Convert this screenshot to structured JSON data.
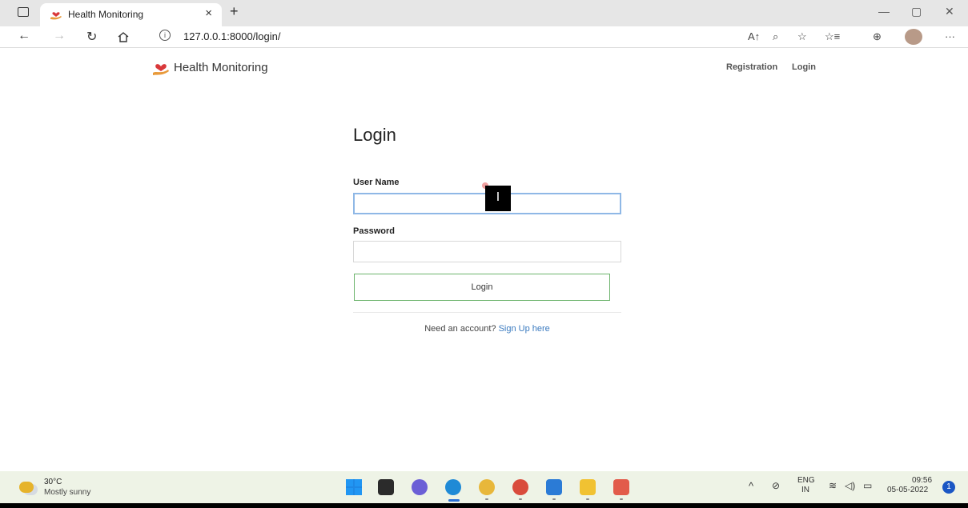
{
  "browser": {
    "tab_title": "Health Monitoring",
    "tab_close": "×",
    "new_tab": "+",
    "url": "127.0.0.1:8000/login/",
    "info_glyph": "i",
    "window_controls": [
      "—",
      "▢",
      "✕"
    ]
  },
  "site": {
    "brand": "Health Monitoring",
    "nav": {
      "registration": "Registration",
      "login": "Login"
    }
  },
  "form": {
    "title": "Login",
    "username_label": "User Name",
    "username_value": "",
    "password_label": "Password",
    "password_value": "",
    "submit_label": "Login",
    "signup_prompt": "Need an account?",
    "signup_link": "Sign Up here"
  },
  "cursor_glyph": "I",
  "taskbar": {
    "weather_temp": "30°C",
    "weather_desc": "Mostly sunny",
    "lang_top": "ENG",
    "lang_bottom": "IN",
    "time": "09:56",
    "date": "05-05-2022",
    "notifications": "1"
  },
  "colors": {
    "accent_link": "#3a7abf",
    "login_button_border": "#6bb36b",
    "focus_border": "#8fb8e6"
  }
}
